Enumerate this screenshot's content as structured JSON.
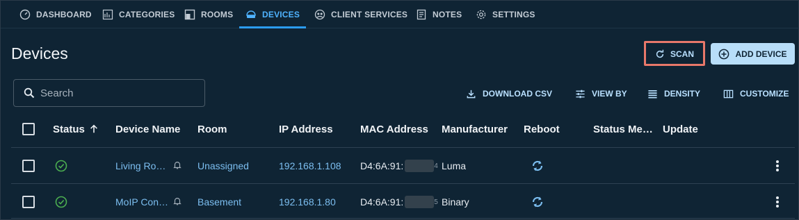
{
  "nav": {
    "items": [
      {
        "label": "DASHBOARD",
        "icon": "speedometer-icon"
      },
      {
        "label": "CATEGORIES",
        "icon": "categories-icon"
      },
      {
        "label": "ROOMS",
        "icon": "rooms-icon"
      },
      {
        "label": "DEVICES",
        "icon": "devices-icon",
        "active": true
      },
      {
        "label": "CLIENT SERVICES",
        "icon": "client-services-icon"
      },
      {
        "label": "NOTES",
        "icon": "notes-icon"
      },
      {
        "label": "SETTINGS",
        "icon": "gear-icon"
      }
    ]
  },
  "page": {
    "title": "Devices",
    "scan_label": "SCAN",
    "add_device_label": "ADD DEVICE"
  },
  "search": {
    "placeholder": "Search"
  },
  "toolbar": {
    "download_csv": "DOWNLOAD CSV",
    "view_by": "VIEW BY",
    "density": "DENSITY",
    "customize": "CUSTOMIZE"
  },
  "table": {
    "headers": {
      "status": "Status",
      "device_name": "Device Name",
      "room": "Room",
      "ip_address": "IP Address",
      "mac_address": "MAC Address",
      "manufacturer": "Manufacturer",
      "reboot": "Reboot",
      "status_message": "Status Me…",
      "update": "Update"
    },
    "rows": [
      {
        "device_name": "Living Ro…",
        "room": "Unassigned",
        "ip": "192.168.1.108",
        "mac_prefix": "D4:6A:91:",
        "mac_suffix": "4",
        "manufacturer": "Luma",
        "status": "online"
      },
      {
        "device_name": "MoIP Con…",
        "room": "Basement",
        "ip": "192.168.1.80",
        "mac_prefix": "D4:6A:91:",
        "mac_suffix": "5",
        "manufacturer": "Binary",
        "status": "online"
      }
    ]
  },
  "colors": {
    "background": "#0f2434",
    "accent": "#2b9cf2",
    "link": "#7cbef0",
    "highlight": "#e8786a",
    "status_ok": "#4caf50"
  }
}
